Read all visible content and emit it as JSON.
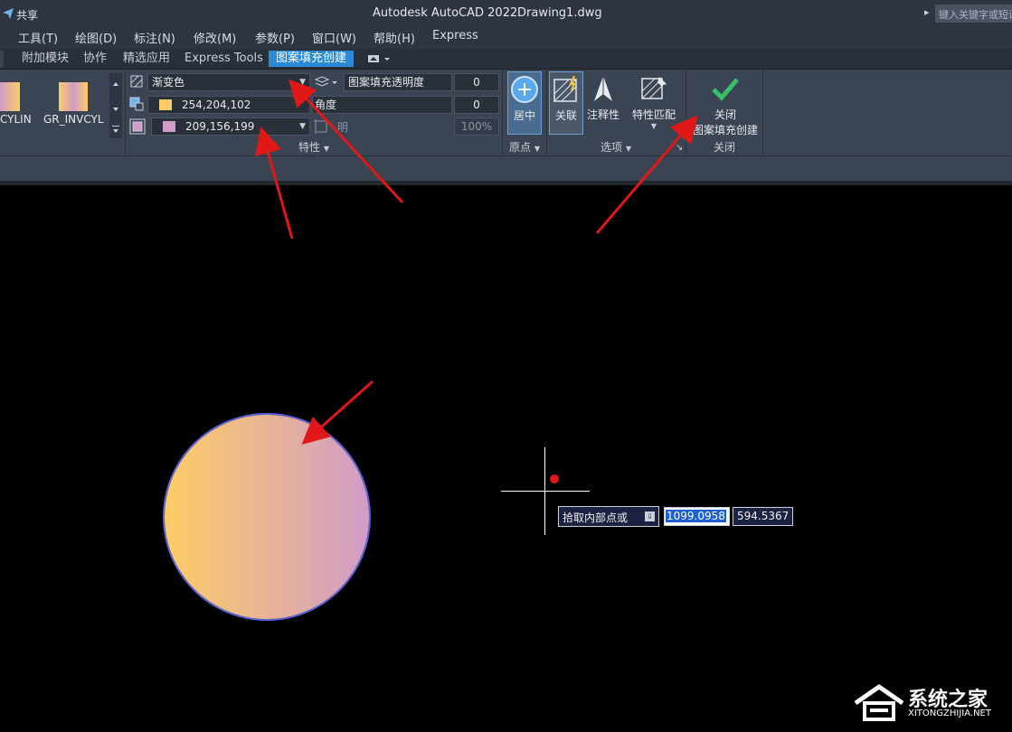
{
  "titlebar": {
    "share": "共享",
    "app_title": "Autodesk AutoCAD 2022",
    "file_name": "Drawing1.dwg",
    "search_placeholder": "键入关键字或短语"
  },
  "menu": [
    "工具(T)",
    "绘图(D)",
    "标注(N)",
    "修改(M)",
    "参数(P)",
    "窗口(W)",
    "帮助(H)",
    "Express"
  ],
  "tabs": [
    "附加模块",
    "协作",
    "精选应用",
    "Express Tools",
    "图案填充创建"
  ],
  "pattern": {
    "items": [
      "CYLIN",
      "GR_INVCYL"
    ]
  },
  "properties": {
    "hatch_type": "渐变色",
    "color1": "254,204,102",
    "color2": "209,156,199",
    "transparency_label": "图案填充透明度",
    "transparency_value": "0",
    "angle_label": "角度",
    "angle_value": "0",
    "tint_label": "明",
    "tint_value": "100%",
    "panel_label": "特性"
  },
  "origin": {
    "center_label": "居中",
    "panel_label": "原点"
  },
  "options": {
    "associative": "关联",
    "annotative": "注释性",
    "match_props": "特性匹配",
    "panel_label": "选项"
  },
  "close": {
    "close_label": "关闭",
    "close_sub": "图案填充创建",
    "panel_label": "关闭"
  },
  "command": {
    "prompt": "拾取内部点或",
    "x_value": "1099.0958",
    "y_value": "594.5367"
  },
  "watermark": {
    "text": "系统之家",
    "sub": "XITONGZHIJIA.NET"
  },
  "colors": {
    "gradient_start": "#FECC66",
    "gradient_end": "#D19CC7",
    "accent": "#2b8ad8",
    "arrow": "#e01818"
  }
}
